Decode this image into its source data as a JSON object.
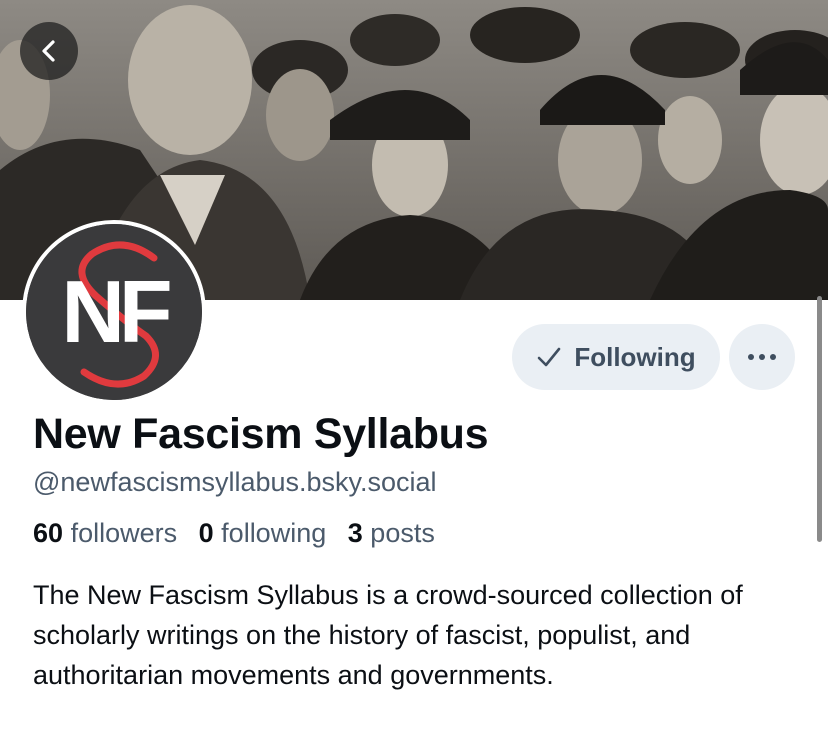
{
  "profile": {
    "display_name": "New Fascism Syllabus",
    "handle": "@newfascismsyllabus.bsky.social",
    "bio": "The New Fascism Syllabus is a crowd-sourced collection of scholarly writings on the history of fascist, populist, and authoritarian movements and governments.",
    "avatar_text": "NF"
  },
  "actions": {
    "following_label": "Following",
    "more_icon": "ellipsis-icon",
    "back_icon": "chevron-left-icon"
  },
  "stats": {
    "followers_count": "60",
    "followers_label": "followers",
    "following_count": "0",
    "following_label": "following",
    "posts_count": "3",
    "posts_label": "posts"
  },
  "colors": {
    "button_bg": "#eaeff4",
    "button_text": "#3f4e5f",
    "muted_text": "#4b5a6b",
    "avatar_red": "#e03a3e"
  }
}
